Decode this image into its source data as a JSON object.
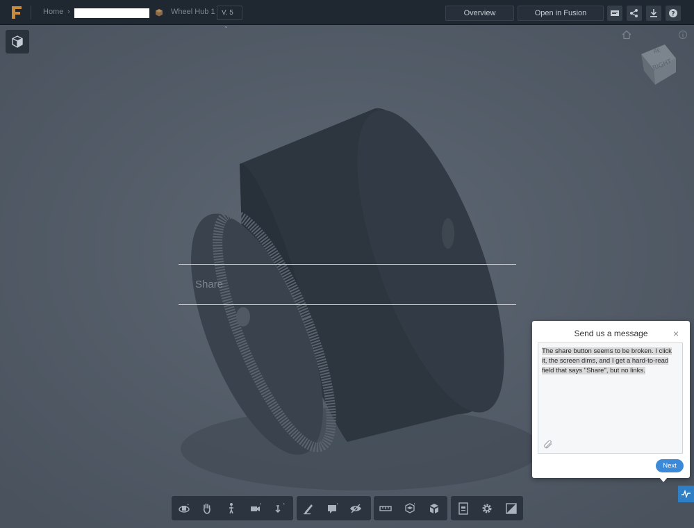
{
  "header": {
    "home_label": "Home",
    "breadcrumb_separator": "›",
    "model_name": "Wheel Hub 1",
    "version_label": "V. 5",
    "overview_label": "Overview",
    "open_label": "Open in Fusion",
    "icons": [
      "comment-icon",
      "share-icon",
      "download-icon",
      "help-icon"
    ]
  },
  "viewer": {
    "navcube_face_top": "RE",
    "navcube_face_right": "RIGHT"
  },
  "share": {
    "label": "Share"
  },
  "message": {
    "title": "Send us a message",
    "close": "×",
    "text": "The share button seems to be broken. I click it, the screen dims, and I get a hard-to-read field that says \"Share\", but no links.",
    "next_label": "Next"
  },
  "toolbar": {
    "groups": [
      [
        "orbit-icon",
        "pan-icon",
        "walk-icon",
        "camera-icon",
        "fit-icon"
      ],
      [
        "markup-icon",
        "comment-tool-icon",
        "visibility-icon"
      ],
      [
        "measure-icon",
        "explode-icon",
        "model-browser-icon"
      ],
      [
        "properties-icon",
        "settings-icon",
        "fullscreen-icon"
      ]
    ]
  },
  "colors": {
    "topbar": "#1f2730",
    "viewport": "#4b5563",
    "accent": "#3c8ad7",
    "logo": "#c98b3a"
  }
}
